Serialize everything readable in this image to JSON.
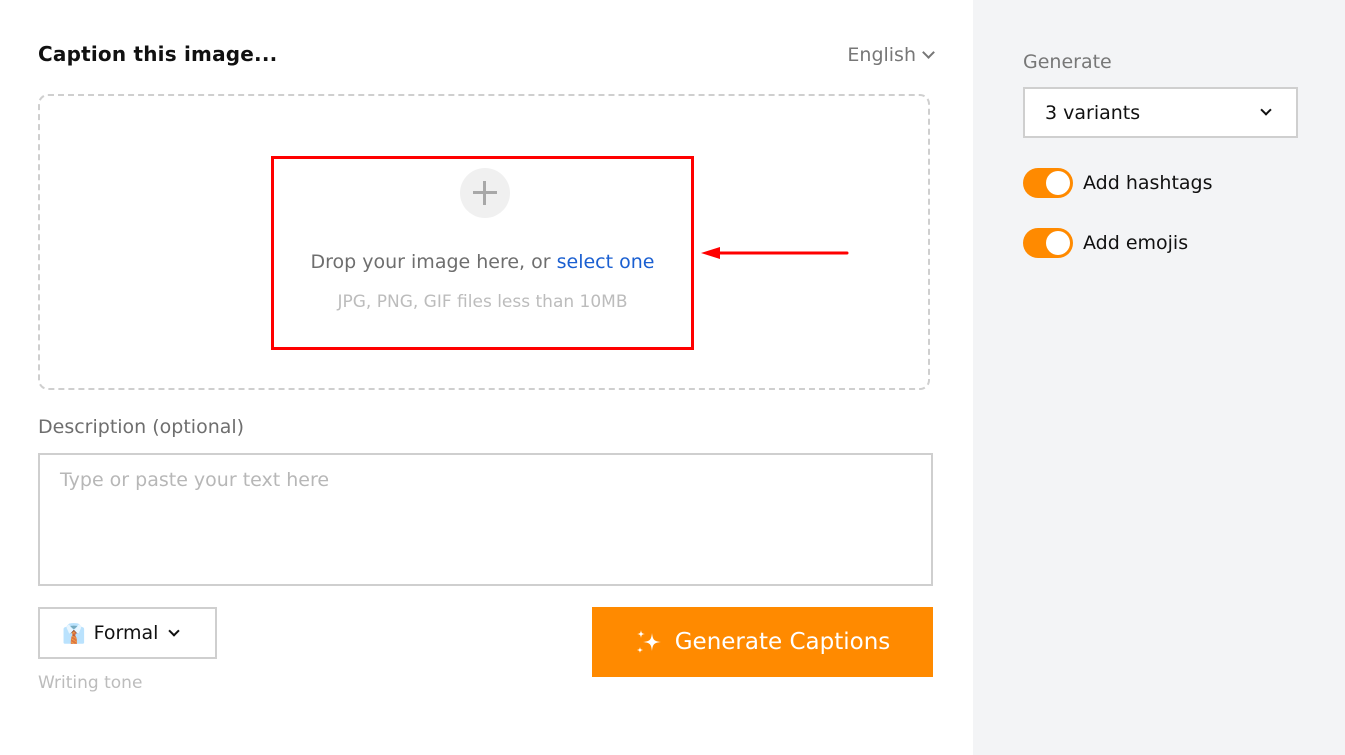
{
  "main": {
    "title": "Caption this image...",
    "language": "English",
    "dropzone": {
      "text": "Drop your image here, or ",
      "link": "select one",
      "hint": "JPG, PNG, GIF files less than 10MB",
      "icon": "plus-icon"
    },
    "description": {
      "label": "Description (optional)",
      "placeholder": "Type or paste your text here",
      "value": ""
    },
    "tone": {
      "emoji": "👔",
      "value": "Formal",
      "label": "Writing tone"
    },
    "generate_button": {
      "icon": "sparkles-icon",
      "label": "Generate Captions"
    }
  },
  "sidebar": {
    "generate_label": "Generate",
    "variants": "3 variants",
    "toggles": [
      {
        "label": "Add hashtags",
        "on": true
      },
      {
        "label": "Add emojis",
        "on": true
      }
    ]
  },
  "colors": {
    "accent": "#ff8a00",
    "link": "#1a5fd1",
    "annotation": "#ff0000"
  }
}
